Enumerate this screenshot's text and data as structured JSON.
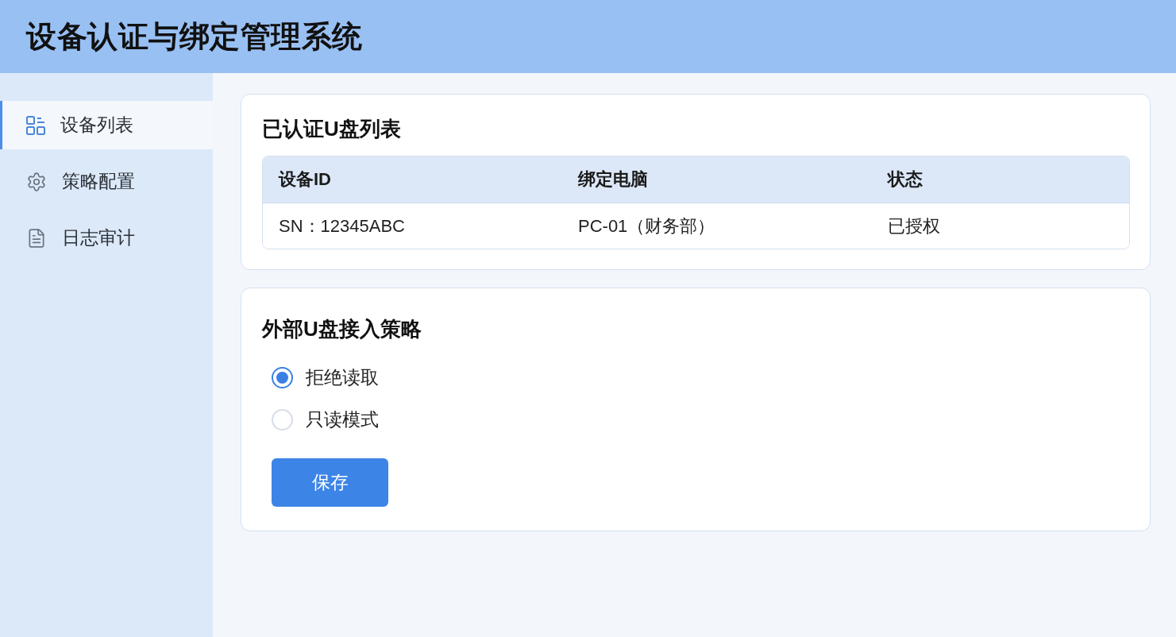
{
  "header": {
    "title": "设备认证与绑定管理系统"
  },
  "sidebar": {
    "items": [
      {
        "label": "设备列表",
        "selected": true
      },
      {
        "label": "策略配置",
        "selected": false
      },
      {
        "label": "日志审计",
        "selected": false
      }
    ]
  },
  "device_card": {
    "title": "已认证U盘列表",
    "table": {
      "columns": [
        "设备ID",
        "绑定电脑",
        "状态"
      ],
      "rows": [
        [
          "SN：12345ABC",
          "PC-01（财务部）",
          "已授权"
        ]
      ]
    }
  },
  "policy_card": {
    "title": "外部U盘接入策略",
    "options": [
      {
        "label": "拒绝读取",
        "selected": true
      },
      {
        "label": "只读模式",
        "selected": false
      }
    ],
    "button": "保存"
  }
}
